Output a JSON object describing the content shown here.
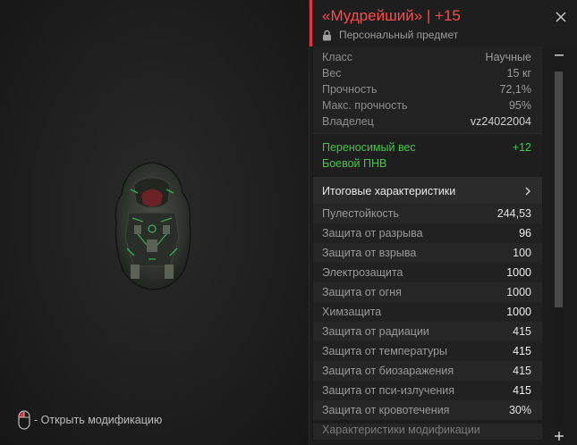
{
  "item": {
    "title": "«Мудрейший» | +15",
    "subtitle": "Персональный предмет"
  },
  "info": [
    {
      "label": "Класс",
      "value": "Научные"
    },
    {
      "label": "Вес",
      "value": "15 кг"
    },
    {
      "label": "Прочность",
      "value": "72,1%"
    },
    {
      "label": "Макс. прочность",
      "value": "95%"
    },
    {
      "label": "Владелец",
      "value": "vz24022004"
    }
  ],
  "bonuses": [
    {
      "label": "Переносимый вес",
      "value": "+12"
    },
    {
      "label": "Боевой ПНВ",
      "value": ""
    }
  ],
  "summary_section": {
    "label": "Итоговые характеристики"
  },
  "stats": [
    {
      "label": "Пулестойкость",
      "value": "244,53"
    },
    {
      "label": "Защита от разрыва",
      "value": "96"
    },
    {
      "label": "Защита от взрыва",
      "value": "100"
    },
    {
      "label": "Электрозащита",
      "value": "1000"
    },
    {
      "label": "Защита от огня",
      "value": "1000"
    },
    {
      "label": "Химзащита",
      "value": "1000"
    },
    {
      "label": "Защита от радиации",
      "value": "415"
    },
    {
      "label": "Защита от температуры",
      "value": "415"
    },
    {
      "label": "Защита от биозаражения",
      "value": "415"
    },
    {
      "label": "Защита от пси-излучения",
      "value": "415"
    },
    {
      "label": "Защита от кровотечения",
      "value": "30%"
    }
  ],
  "next_section": {
    "label": "Характеристики модификации"
  },
  "hint": {
    "text": "- Открыть модификацию"
  },
  "colors": {
    "accent": "#e5343b",
    "bonus": "#45c54a",
    "title": "#ff4a4a"
  }
}
